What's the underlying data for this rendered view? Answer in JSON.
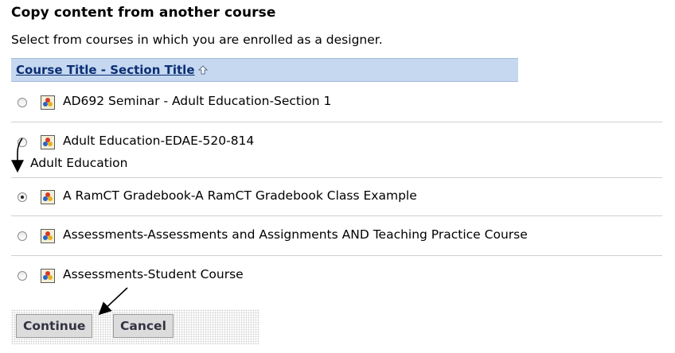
{
  "page": {
    "title": "Copy content from another course",
    "instructions": "Select from courses in which you are enrolled as a designer."
  },
  "table": {
    "header_label": "Course Title - Section Title",
    "sort_icon": "sort-ascending-arrow-icon",
    "rows": [
      {
        "name": "AD692 Seminar - Adult Education-Section 1",
        "sub": "",
        "selected": false
      },
      {
        "name": "Adult Education-EDAE-520-814",
        "sub": "Adult Education",
        "selected": false
      },
      {
        "name": "A RamCT Gradebook-A RamCT Gradebook Class Example",
        "sub": "",
        "selected": true
      },
      {
        "name": "Assessments-Assessments and Assignments AND Teaching Practice Course",
        "sub": "",
        "selected": false
      },
      {
        "name": "Assessments-Student Course",
        "sub": "",
        "selected": false
      }
    ],
    "row_icon": "course-people-icon"
  },
  "buttons": {
    "continue_label": "Continue",
    "cancel_label": "Cancel"
  },
  "colors": {
    "header_bg": "#c6d7f0",
    "header_link": "#0a2f73",
    "button_bg": "#dcdcdc"
  }
}
